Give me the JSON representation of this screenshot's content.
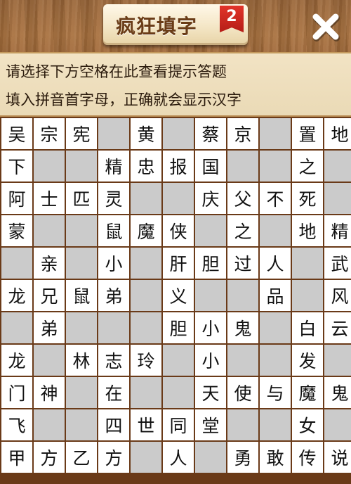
{
  "header": {
    "title": "疯狂填字",
    "badge": "2",
    "close_icon": "close-x-icon"
  },
  "hints": {
    "line1": "请选择下方空格在此查看提示答题",
    "line2": "填入拼音首字母，正确就会显示汉字"
  },
  "grid": {
    "rows": [
      [
        "吴",
        "宗",
        "宪",
        null,
        "黄",
        null,
        "蔡",
        "京",
        null,
        "置",
        "地"
      ],
      [
        "下",
        "",
        "",
        "精",
        "忠",
        "报",
        "国",
        "",
        "",
        "之",
        ""
      ],
      [
        "阿",
        "士",
        "匹",
        "灵",
        "",
        "",
        "庆",
        "父",
        "不",
        "死",
        ""
      ],
      [
        "蒙",
        "",
        "",
        "鼠",
        "魔",
        "侠",
        "",
        "之",
        "",
        "地",
        "精"
      ],
      [
        "",
        "亲",
        "",
        "小",
        "",
        "肝",
        "胆",
        "过",
        "人",
        "",
        "武"
      ],
      [
        "龙",
        "兄",
        "鼠",
        "弟",
        "",
        "义",
        "",
        "",
        "品",
        "",
        "风"
      ],
      [
        "",
        "弟",
        "",
        "",
        "",
        "胆",
        "小",
        "鬼",
        "",
        "白",
        "云"
      ],
      [
        "龙",
        "",
        "林",
        "志",
        "玲",
        "",
        "小",
        "",
        "",
        "发",
        ""
      ],
      [
        "门",
        "神",
        "",
        "在",
        "",
        "",
        "天",
        "使",
        "与",
        "魔",
        "鬼"
      ],
      [
        "飞",
        "",
        "",
        "四",
        "世",
        "同",
        "堂",
        "",
        "",
        "女",
        ""
      ],
      [
        "甲",
        "方",
        "乙",
        "方",
        "",
        "人",
        "",
        "勇",
        "敢",
        "传",
        "说"
      ]
    ],
    "white_mask": [
      [
        1,
        1,
        1,
        0,
        1,
        0,
        1,
        1,
        0,
        1,
        1
      ],
      [
        1,
        0,
        0,
        1,
        1,
        1,
        1,
        0,
        0,
        1,
        0
      ],
      [
        1,
        1,
        1,
        1,
        0,
        0,
        1,
        1,
        1,
        1,
        0
      ],
      [
        1,
        0,
        0,
        1,
        1,
        1,
        0,
        1,
        0,
        1,
        1
      ],
      [
        0,
        1,
        0,
        1,
        0,
        1,
        1,
        1,
        1,
        0,
        1
      ],
      [
        1,
        1,
        1,
        1,
        0,
        1,
        0,
        0,
        1,
        0,
        1
      ],
      [
        0,
        1,
        0,
        0,
        0,
        1,
        1,
        1,
        0,
        1,
        1
      ],
      [
        1,
        0,
        1,
        1,
        1,
        0,
        1,
        0,
        0,
        1,
        0
      ],
      [
        1,
        1,
        0,
        1,
        0,
        0,
        1,
        1,
        1,
        1,
        1
      ],
      [
        1,
        0,
        0,
        1,
        1,
        1,
        1,
        0,
        0,
        1,
        0
      ],
      [
        1,
        1,
        1,
        1,
        0,
        1,
        0,
        1,
        1,
        1,
        1
      ]
    ]
  },
  "colors": {
    "wood": "#9a6638",
    "grid_line": "#6a3a18",
    "cell_white": "#ffffff",
    "cell_blank": "#cbcbcb",
    "badge_red": "#d12a22"
  }
}
